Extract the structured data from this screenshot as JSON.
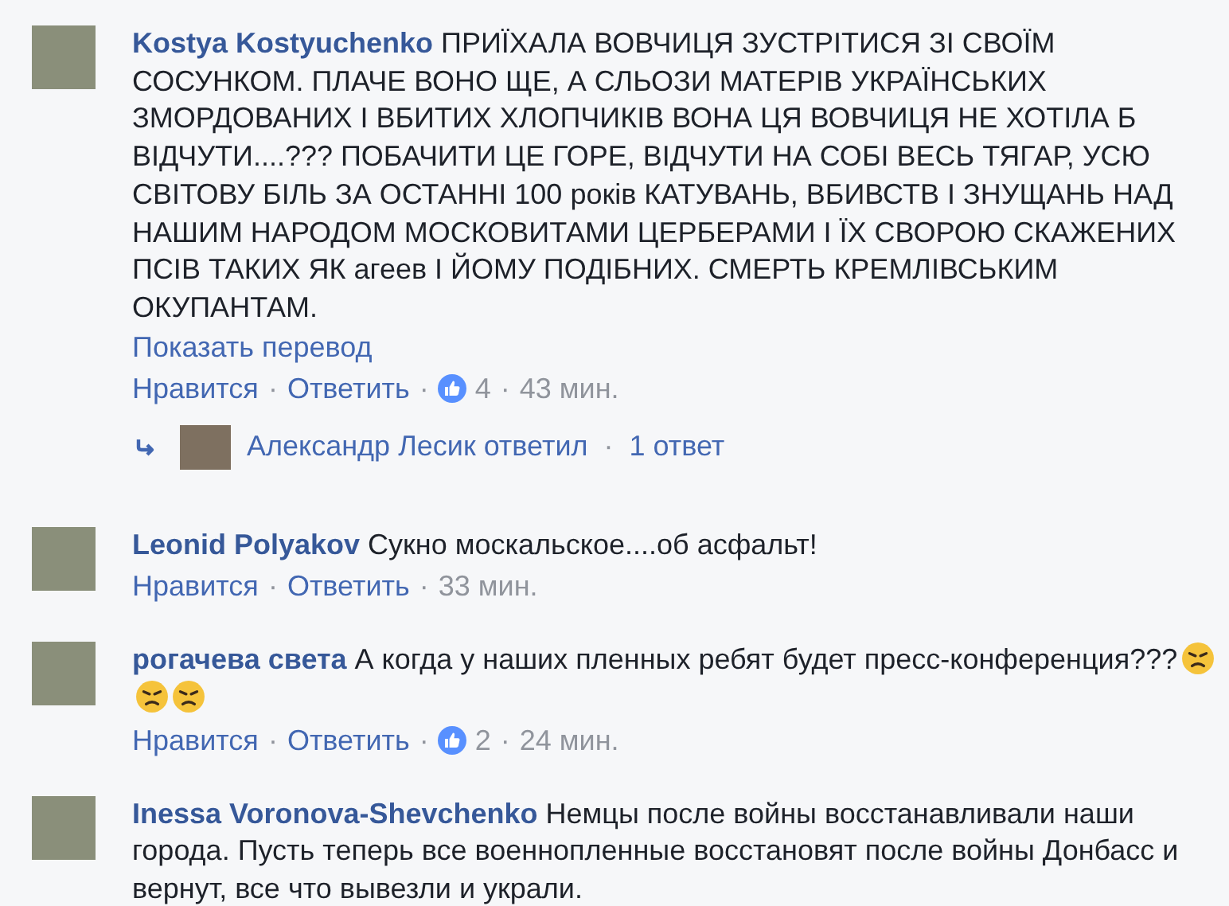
{
  "comments": [
    {
      "author": "Kostya Kostyuchenko",
      "text": "ПРИЇХАЛА ВОВЧИЦЯ ЗУСТРІТИСЯ ЗІ СВОЇМ СОСУНКОМ. ПЛАЧЕ ВОНО ЩЕ, А СЛЬОЗИ МАТЕРІВ УКРАЇНСЬКИХ ЗМОРДОВАНИХ І ВБИТИХ ХЛОПЧИКІВ ВОНА ЦЯ ВОВЧИЦЯ НЕ ХОТІЛА Б ВІДЧУТИ....??? ПОБАЧИТИ ЦЕ ГОРЕ, ВІДЧУТИ НА СОБІ ВЕСЬ ТЯГАР, УСЮ СВІТОВУ БІЛЬ ЗА ОСТАННІ 100 років КАТУВАНЬ, ВБИВСТВ І ЗНУЩАНЬ НАД НАШИМ НАРОДОМ МОСКОВИТАМИ ЦЕРБЕРАМИ І ЇХ СВОРОЮ СКАЖЕНИХ ПСІВ ТАКИХ ЯК агеев І ЙОМУ ПОДІБНИХ. СМЕРТЬ КРЕМЛІВСЬКИМ ОКУПАНТАМ.",
      "translate": "Показать перевод",
      "actions": [
        {
          "kind": "link",
          "text": "Нравится"
        },
        {
          "kind": "sep",
          "text": "·"
        },
        {
          "kind": "link",
          "text": "Ответить"
        },
        {
          "kind": "sep",
          "text": "·"
        },
        {
          "kind": "likes",
          "text": "4"
        },
        {
          "kind": "sep",
          "text": "·"
        },
        {
          "kind": "time",
          "text": "43 мин."
        }
      ],
      "replies": {
        "author_text": "Александр Лесик ответил",
        "sep": "·",
        "count": "1 ответ"
      }
    },
    {
      "author": "Leonid Polyakov",
      "text": "Сукно москальское....об асфальт!",
      "actions": [
        {
          "kind": "link",
          "text": "Нравится"
        },
        {
          "kind": "sep",
          "text": "·"
        },
        {
          "kind": "link",
          "text": "Ответить"
        },
        {
          "kind": "sep",
          "text": "·"
        },
        {
          "kind": "time",
          "text": "33 мин."
        }
      ]
    },
    {
      "author": "рогачева света",
      "text": "А когда у наших пленных ребят будет пресс-конференция???",
      "emoji": [
        {
          "kind": "angry"
        },
        {
          "kind": "angry"
        },
        {
          "kind": "angry"
        }
      ],
      "actions": [
        {
          "kind": "link",
          "text": "Нравится"
        },
        {
          "kind": "sep",
          "text": "·"
        },
        {
          "kind": "link",
          "text": "Ответить"
        },
        {
          "kind": "sep",
          "text": "·"
        },
        {
          "kind": "likes",
          "text": "2"
        },
        {
          "kind": "sep",
          "text": "·"
        },
        {
          "kind": "time",
          "text": "24 мин."
        }
      ]
    },
    {
      "author": "Inessa Voronova-Shevchenko",
      "text": "Немцы после войны восстанавливали наши города. Пусть теперь все военнопленные восстановят после войны Донбасс и вернут, все что вывезли и украли."
    }
  ]
}
